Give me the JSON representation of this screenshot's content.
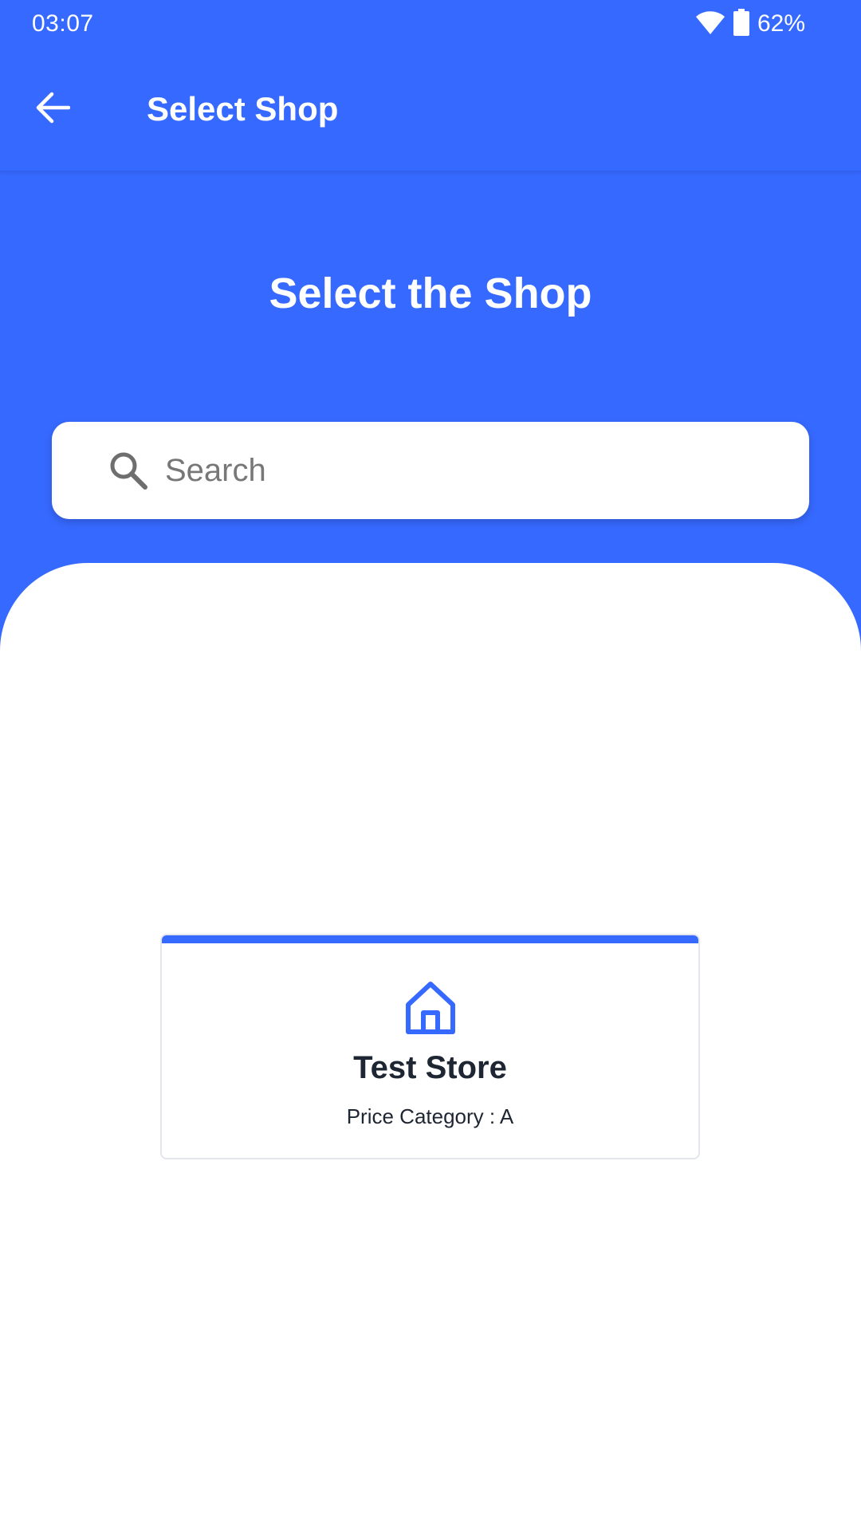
{
  "status_bar": {
    "time": "03:07",
    "battery": "62%",
    "icons": [
      "wifi-icon",
      "battery-icon"
    ]
  },
  "app_bar": {
    "title": "Select Shop",
    "back_icon": "arrow-back-icon"
  },
  "hero": {
    "title": "Select the Shop"
  },
  "search": {
    "placeholder": "Search",
    "value": "",
    "icon": "search-icon"
  },
  "shops": [
    {
      "name": "Test Store",
      "price_category": "Price Category : A",
      "icon": "home-icon"
    }
  ],
  "colors": {
    "primary": "#3669FF",
    "background": "#FFFFFF",
    "text_dark": "#1E2533",
    "placeholder": "#777777"
  }
}
